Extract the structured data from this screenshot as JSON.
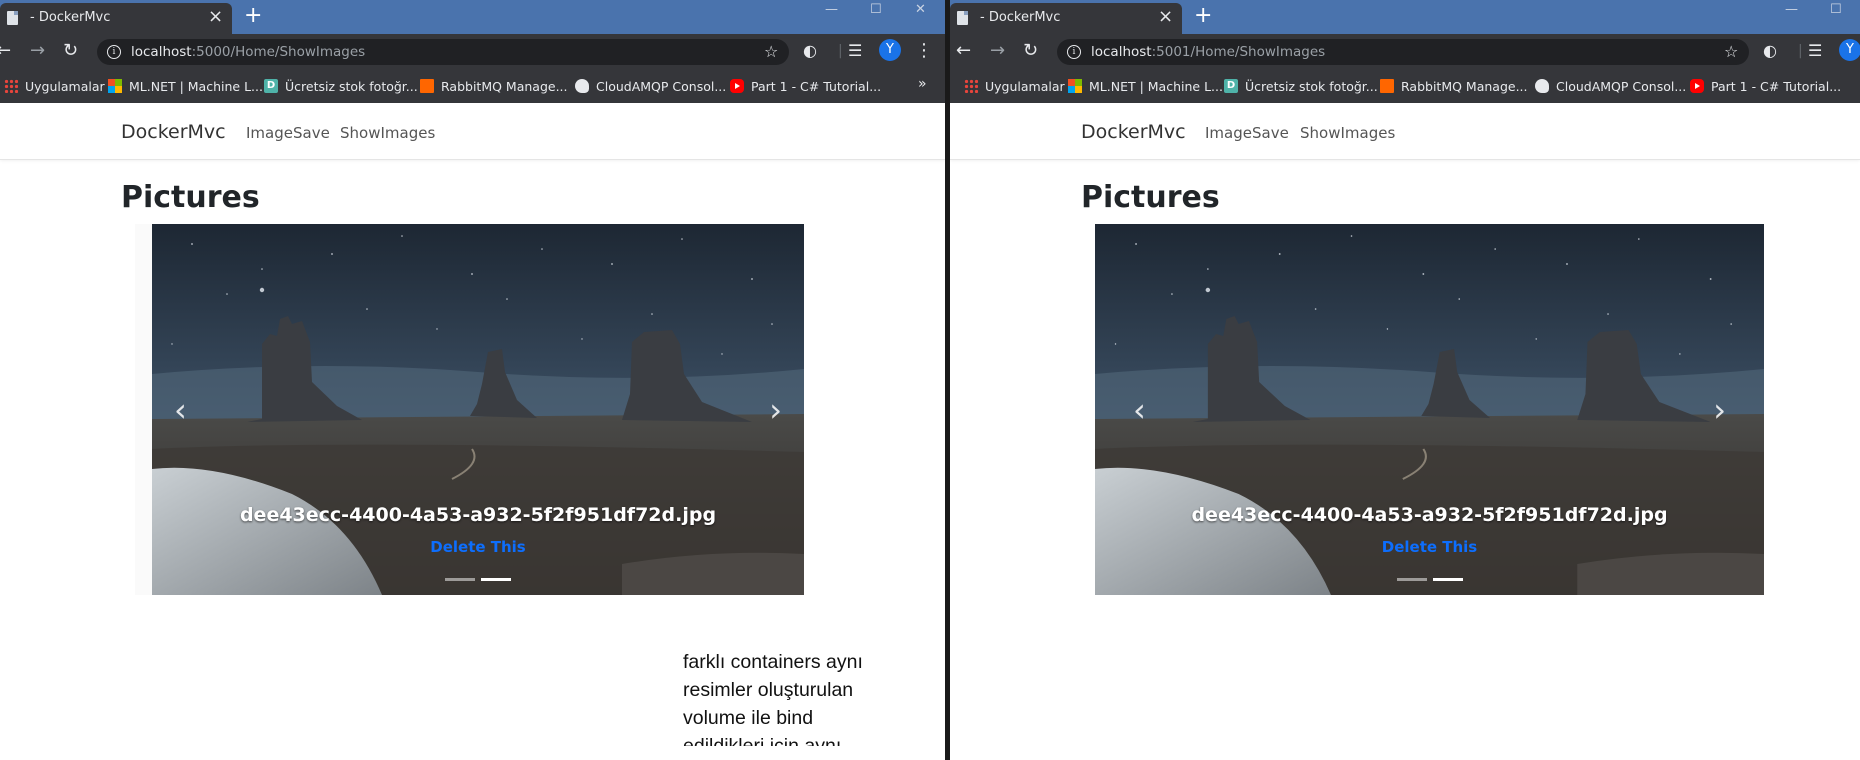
{
  "left_window": {
    "tab_title": "- DockerMvc",
    "url_host": "localhost",
    "url_path": ":5000/Home/ShowImages",
    "avatar_letter": "Y",
    "bookmarks": [
      {
        "label": "Uygulamalar",
        "icon": "apps-grid-icon"
      },
      {
        "label": "ML.NET | Machine L...",
        "icon": "microsoft-icon"
      },
      {
        "label": "Ücretsiz stok fotoğr...",
        "icon": "d-icon"
      },
      {
        "label": "RabbitMQ Manage...",
        "icon": "rabbitmq-icon"
      },
      {
        "label": "CloudAMQP Consol...",
        "icon": "cloudamqp-icon"
      },
      {
        "label": "Part 1 - C# Tutorial...",
        "icon": "youtube-icon"
      }
    ],
    "bookmarks_more": "»",
    "navbar": {
      "brand": "DockerMvc",
      "links": [
        "ImageSave",
        "ShowImages"
      ]
    },
    "heading": "Pictures",
    "carousel": {
      "caption": "dee43ecc-4400-4a53-a932-5f2f951df72d.jpg",
      "delete_label": "Delete This",
      "slide_count": 2,
      "active_slide": 2
    },
    "note_lines": [
      "farklı containers aynı",
      "resimler oluşturulan",
      "volume ile bind",
      "edildikleri için aynı"
    ]
  },
  "right_window": {
    "tab_title": "- DockerMvc",
    "url_host": "localhost",
    "url_path": ":5001/Home/ShowImages",
    "avatar_letter": "Y",
    "bookmarks": [
      {
        "label": "Uygulamalar",
        "icon": "apps-grid-icon"
      },
      {
        "label": "ML.NET | Machine L...",
        "icon": "microsoft-icon"
      },
      {
        "label": "Ücretsiz stok fotoğr...",
        "icon": "d-icon"
      },
      {
        "label": "RabbitMQ Manage...",
        "icon": "rabbitmq-icon"
      },
      {
        "label": "CloudAMQP Consol...",
        "icon": "cloudamqp-icon"
      },
      {
        "label": "Part 1 - C# Tutorial...",
        "icon": "youtube-icon"
      }
    ],
    "navbar": {
      "brand": "DockerMvc",
      "links": [
        "ImageSave",
        "ShowImages"
      ]
    },
    "heading": "Pictures",
    "carousel": {
      "caption": "dee43ecc-4400-4a53-a932-5f2f951df72d.jpg",
      "delete_label": "Delete This",
      "slide_count": 2,
      "active_slide": 2
    }
  },
  "colors": {
    "title_bar": "#4a73ad",
    "chrome_dark": "#35363a",
    "link_blue": "#0d6efd",
    "avatar_blue": "#1a73e8"
  }
}
